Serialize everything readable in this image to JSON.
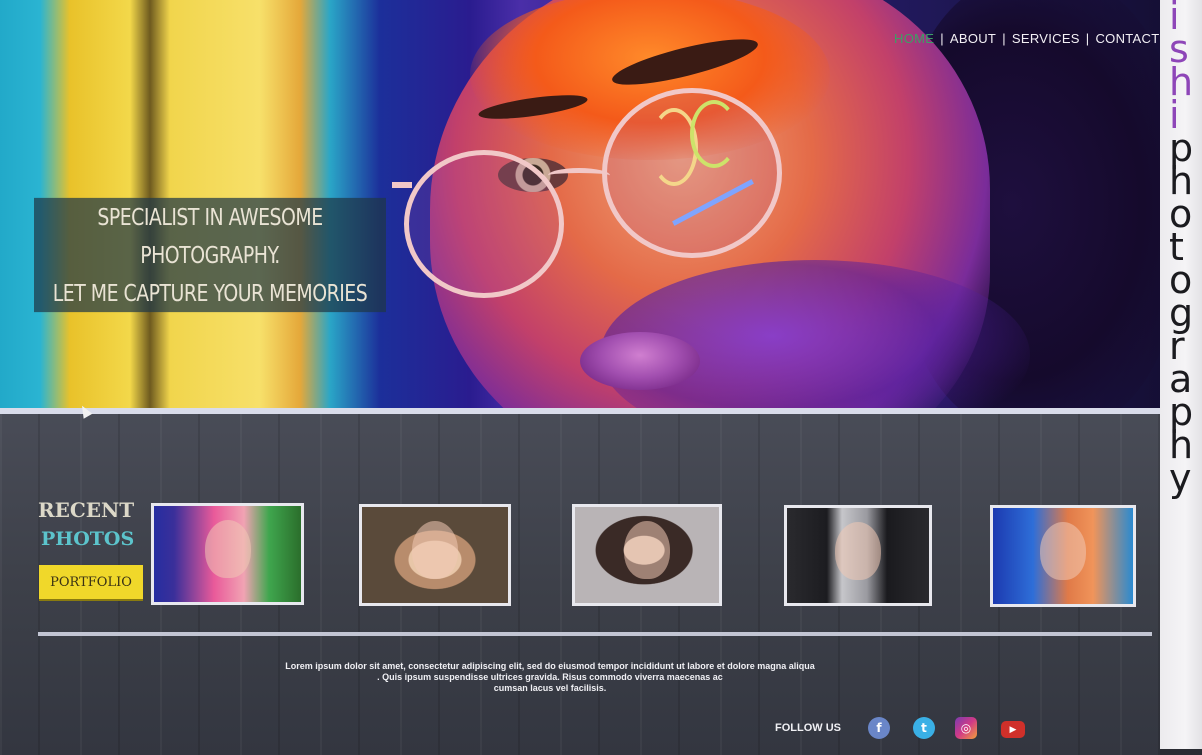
{
  "nav": {
    "items": [
      {
        "label": "HOME",
        "active": true
      },
      {
        "label": "ABOUT",
        "active": false
      },
      {
        "label": "SERVICES",
        "active": false
      },
      {
        "label": "CONTACT",
        "active": false
      }
    ],
    "separator": "|"
  },
  "hero": {
    "tagline_line1": "SPECIALIST IN AWESOME",
    "tagline_line2": "PHOTOGRAPHY.",
    "tagline_line3": "LET ME CAPTURE YOUR MEMORIES"
  },
  "recent": {
    "title_line1": "RECENT",
    "title_line2": "PHOTOS",
    "button_label": "PORTFOLIO"
  },
  "footer": {
    "lorem_line1": "Lorem ipsum dolor sit amet, consectetur adipiscing elit, sed do eiusmod tempor incididunt ut labore et dolore magna aliqua",
    "lorem_line2": ". Quis ipsum suspendisse ultrices gravida. Risus commodo viverra maecenas ac",
    "lorem_line3": "cumsan lacus vel facilisis.",
    "follow_label": "FOLLOW US",
    "social": [
      "facebook-icon",
      "twitter-icon",
      "instagram-icon",
      "youtube-icon"
    ]
  },
  "brand": {
    "part1": "ishi",
    "part2": "photography",
    "letters1": [
      "i",
      "s",
      "h",
      "i"
    ],
    "letters2": [
      "p",
      "h",
      "o",
      "t",
      "o",
      "g",
      "r",
      "a",
      "p",
      "h",
      "y"
    ]
  },
  "colors": {
    "nav_active": "#3d9f64",
    "button": "#f0d82a",
    "brand_accent": "#8e46b8",
    "photos_title": "#5cc4cc"
  }
}
